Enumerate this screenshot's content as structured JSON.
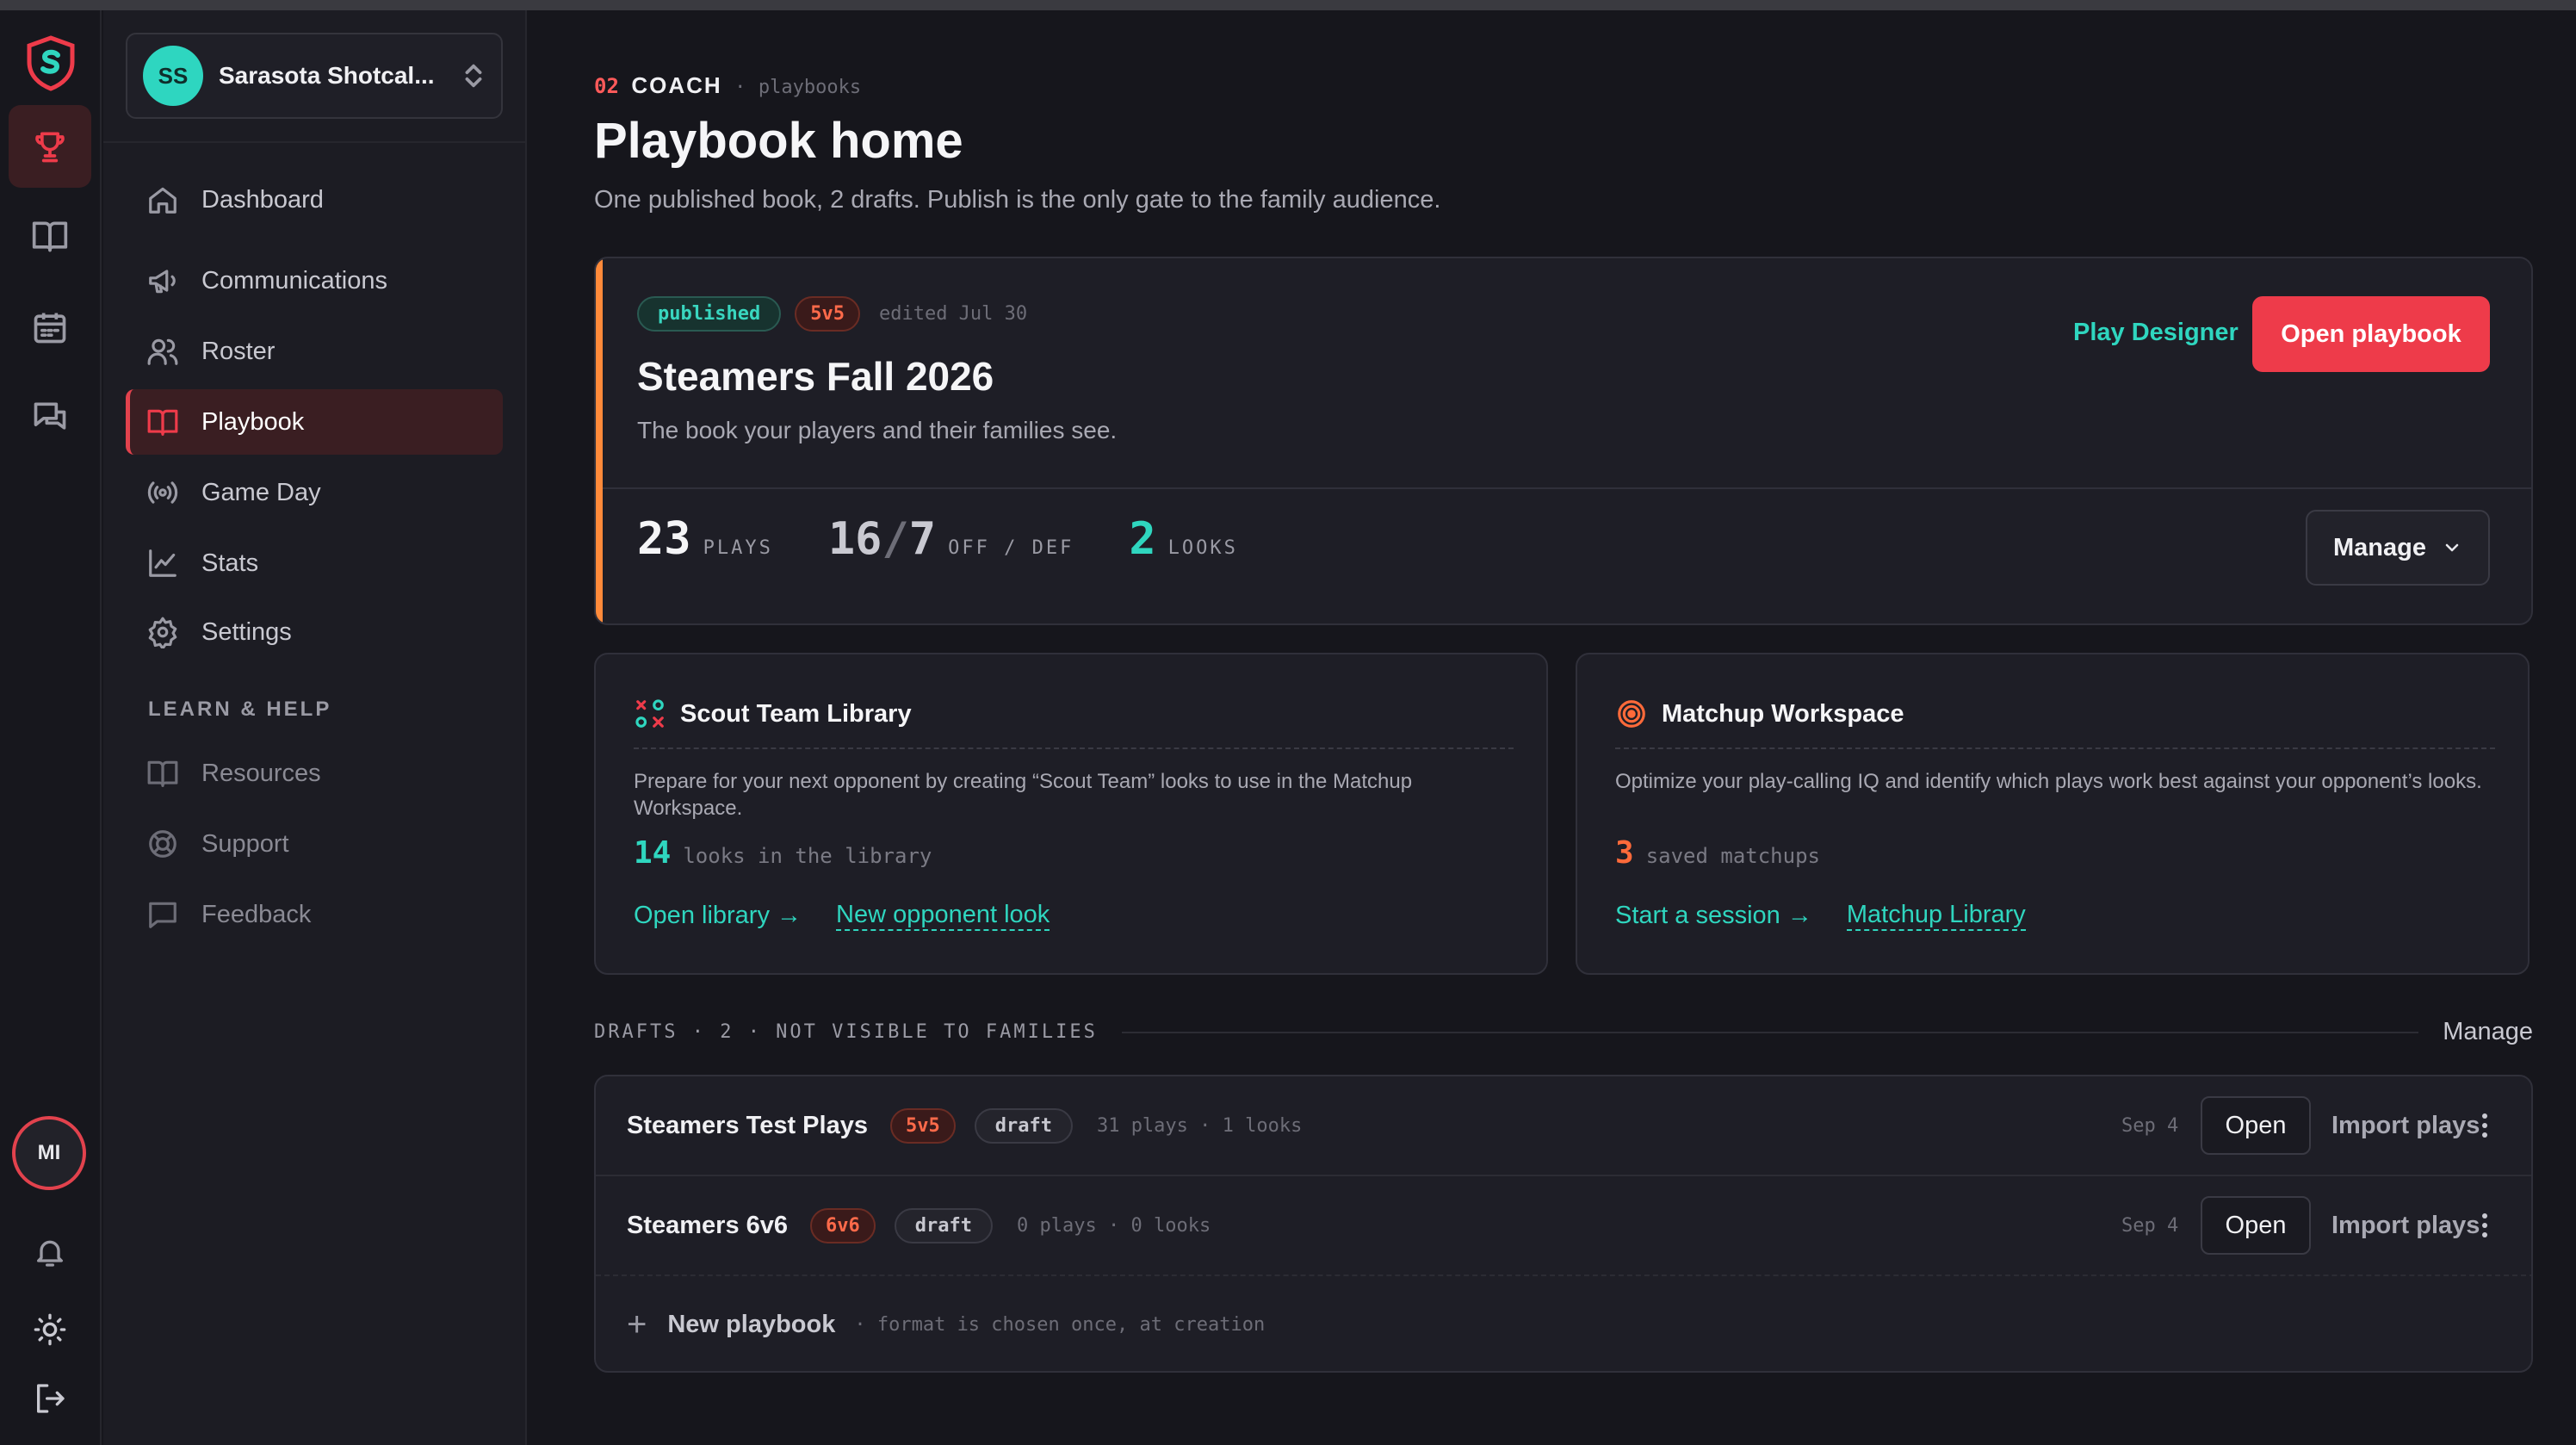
{
  "rail": {
    "avatar_initials": "MI",
    "icons": [
      "shield-logo-icon",
      "trophy-icon",
      "book-icon",
      "calendar-icon",
      "chat-icon",
      "bell-icon",
      "sun-icon",
      "logout-icon"
    ]
  },
  "team": {
    "initials": "SS",
    "name": "Sarasota Shotcal..."
  },
  "nav": {
    "items": [
      {
        "label": "Dashboard",
        "icon": "home-icon"
      },
      {
        "label": "Communications",
        "icon": "megaphone-icon"
      },
      {
        "label": "Roster",
        "icon": "users-icon"
      },
      {
        "label": "Playbook",
        "icon": "book-icon"
      },
      {
        "label": "Game Day",
        "icon": "broadcast-icon"
      },
      {
        "label": "Stats",
        "icon": "chart-icon"
      },
      {
        "label": "Settings",
        "icon": "gear-icon"
      }
    ],
    "section_label": "LEARN & HELP",
    "help_items": [
      {
        "label": "Resources",
        "icon": "book-icon"
      },
      {
        "label": "Support",
        "icon": "lifebuoy-icon"
      },
      {
        "label": "Feedback",
        "icon": "message-icon"
      }
    ]
  },
  "header": {
    "step": "02",
    "role": "COACH",
    "sep": "·",
    "section": "playbooks",
    "title": "Playbook home",
    "subtitle": "One published book, 2 drafts. Publish is the only gate to the family audience."
  },
  "published": {
    "status": "published",
    "format": "5v5",
    "edited": "edited Jul 30",
    "title": "Steamers Fall 2026",
    "description": "The book your players and their families see.",
    "play_designer_label": "Play Designer",
    "open_label": "Open playbook",
    "plays_value": "23",
    "plays_label": "PLAYS",
    "offdef_off": "16",
    "offdef_slash": "/",
    "offdef_def": "7",
    "offdef_label": "OFF / DEF",
    "looks_value": "2",
    "looks_label": "LOOKS",
    "manage_label": "Manage"
  },
  "scout": {
    "title": "Scout Team Library",
    "text": "Prepare for your next opponent by creating “Scout Team” looks to use in the Matchup Workspace.",
    "count": "14",
    "count_label": "looks in the library",
    "link1": "Open library →",
    "link2": "New opponent look"
  },
  "matchup": {
    "title": "Matchup Workspace",
    "text": "Optimize your play-calling IQ and identify which plays work best against your opponent’s looks.",
    "count": "3",
    "count_label": "saved matchups",
    "link1": "Start a session →",
    "link2": "Matchup Library"
  },
  "drafts": {
    "header": "DRAFTS · 2 · NOT VISIBLE TO FAMILIES",
    "manage_label": "Manage",
    "rows": [
      {
        "name": "Steamers Test Plays",
        "format": "5v5",
        "status": "draft",
        "meta": "31 plays · 1 looks",
        "date": "Sep 4",
        "open": "Open",
        "import": "Import plays"
      },
      {
        "name": "Steamers 6v6",
        "format": "6v6",
        "status": "draft",
        "meta": "0 plays · 0 looks",
        "date": "Sep 4",
        "open": "Open",
        "import": "Import plays"
      }
    ],
    "new_label": "New playbook",
    "new_hint": "· format is chosen once, at creation"
  },
  "colors": {
    "accent": "#ee3b4a",
    "teal": "#2fd6bf",
    "orange": "#ff6a3a",
    "bg": "#16161c"
  }
}
